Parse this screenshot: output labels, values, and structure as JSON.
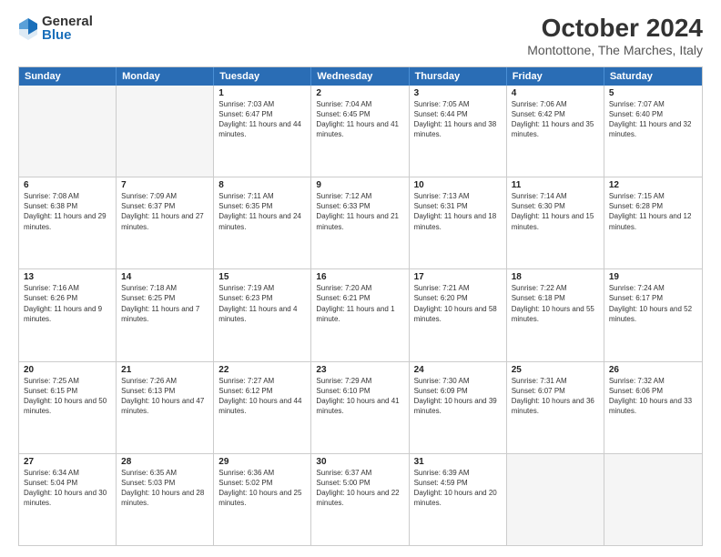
{
  "logo": {
    "general": "General",
    "blue": "Blue"
  },
  "title": "October 2024",
  "location": "Montottone, The Marches, Italy",
  "days": [
    "Sunday",
    "Monday",
    "Tuesday",
    "Wednesday",
    "Thursday",
    "Friday",
    "Saturday"
  ],
  "weeks": [
    [
      {
        "day": "",
        "empty": true
      },
      {
        "day": "",
        "empty": true
      },
      {
        "day": "1",
        "sunrise": "Sunrise: 7:03 AM",
        "sunset": "Sunset: 6:47 PM",
        "daylight": "Daylight: 11 hours and 44 minutes."
      },
      {
        "day": "2",
        "sunrise": "Sunrise: 7:04 AM",
        "sunset": "Sunset: 6:45 PM",
        "daylight": "Daylight: 11 hours and 41 minutes."
      },
      {
        "day": "3",
        "sunrise": "Sunrise: 7:05 AM",
        "sunset": "Sunset: 6:44 PM",
        "daylight": "Daylight: 11 hours and 38 minutes."
      },
      {
        "day": "4",
        "sunrise": "Sunrise: 7:06 AM",
        "sunset": "Sunset: 6:42 PM",
        "daylight": "Daylight: 11 hours and 35 minutes."
      },
      {
        "day": "5",
        "sunrise": "Sunrise: 7:07 AM",
        "sunset": "Sunset: 6:40 PM",
        "daylight": "Daylight: 11 hours and 32 minutes."
      }
    ],
    [
      {
        "day": "6",
        "sunrise": "Sunrise: 7:08 AM",
        "sunset": "Sunset: 6:38 PM",
        "daylight": "Daylight: 11 hours and 29 minutes."
      },
      {
        "day": "7",
        "sunrise": "Sunrise: 7:09 AM",
        "sunset": "Sunset: 6:37 PM",
        "daylight": "Daylight: 11 hours and 27 minutes."
      },
      {
        "day": "8",
        "sunrise": "Sunrise: 7:11 AM",
        "sunset": "Sunset: 6:35 PM",
        "daylight": "Daylight: 11 hours and 24 minutes."
      },
      {
        "day": "9",
        "sunrise": "Sunrise: 7:12 AM",
        "sunset": "Sunset: 6:33 PM",
        "daylight": "Daylight: 11 hours and 21 minutes."
      },
      {
        "day": "10",
        "sunrise": "Sunrise: 7:13 AM",
        "sunset": "Sunset: 6:31 PM",
        "daylight": "Daylight: 11 hours and 18 minutes."
      },
      {
        "day": "11",
        "sunrise": "Sunrise: 7:14 AM",
        "sunset": "Sunset: 6:30 PM",
        "daylight": "Daylight: 11 hours and 15 minutes."
      },
      {
        "day": "12",
        "sunrise": "Sunrise: 7:15 AM",
        "sunset": "Sunset: 6:28 PM",
        "daylight": "Daylight: 11 hours and 12 minutes."
      }
    ],
    [
      {
        "day": "13",
        "sunrise": "Sunrise: 7:16 AM",
        "sunset": "Sunset: 6:26 PM",
        "daylight": "Daylight: 11 hours and 9 minutes."
      },
      {
        "day": "14",
        "sunrise": "Sunrise: 7:18 AM",
        "sunset": "Sunset: 6:25 PM",
        "daylight": "Daylight: 11 hours and 7 minutes."
      },
      {
        "day": "15",
        "sunrise": "Sunrise: 7:19 AM",
        "sunset": "Sunset: 6:23 PM",
        "daylight": "Daylight: 11 hours and 4 minutes."
      },
      {
        "day": "16",
        "sunrise": "Sunrise: 7:20 AM",
        "sunset": "Sunset: 6:21 PM",
        "daylight": "Daylight: 11 hours and 1 minute."
      },
      {
        "day": "17",
        "sunrise": "Sunrise: 7:21 AM",
        "sunset": "Sunset: 6:20 PM",
        "daylight": "Daylight: 10 hours and 58 minutes."
      },
      {
        "day": "18",
        "sunrise": "Sunrise: 7:22 AM",
        "sunset": "Sunset: 6:18 PM",
        "daylight": "Daylight: 10 hours and 55 minutes."
      },
      {
        "day": "19",
        "sunrise": "Sunrise: 7:24 AM",
        "sunset": "Sunset: 6:17 PM",
        "daylight": "Daylight: 10 hours and 52 minutes."
      }
    ],
    [
      {
        "day": "20",
        "sunrise": "Sunrise: 7:25 AM",
        "sunset": "Sunset: 6:15 PM",
        "daylight": "Daylight: 10 hours and 50 minutes."
      },
      {
        "day": "21",
        "sunrise": "Sunrise: 7:26 AM",
        "sunset": "Sunset: 6:13 PM",
        "daylight": "Daylight: 10 hours and 47 minutes."
      },
      {
        "day": "22",
        "sunrise": "Sunrise: 7:27 AM",
        "sunset": "Sunset: 6:12 PM",
        "daylight": "Daylight: 10 hours and 44 minutes."
      },
      {
        "day": "23",
        "sunrise": "Sunrise: 7:29 AM",
        "sunset": "Sunset: 6:10 PM",
        "daylight": "Daylight: 10 hours and 41 minutes."
      },
      {
        "day": "24",
        "sunrise": "Sunrise: 7:30 AM",
        "sunset": "Sunset: 6:09 PM",
        "daylight": "Daylight: 10 hours and 39 minutes."
      },
      {
        "day": "25",
        "sunrise": "Sunrise: 7:31 AM",
        "sunset": "Sunset: 6:07 PM",
        "daylight": "Daylight: 10 hours and 36 minutes."
      },
      {
        "day": "26",
        "sunrise": "Sunrise: 7:32 AM",
        "sunset": "Sunset: 6:06 PM",
        "daylight": "Daylight: 10 hours and 33 minutes."
      }
    ],
    [
      {
        "day": "27",
        "sunrise": "Sunrise: 6:34 AM",
        "sunset": "Sunset: 5:04 PM",
        "daylight": "Daylight: 10 hours and 30 minutes."
      },
      {
        "day": "28",
        "sunrise": "Sunrise: 6:35 AM",
        "sunset": "Sunset: 5:03 PM",
        "daylight": "Daylight: 10 hours and 28 minutes."
      },
      {
        "day": "29",
        "sunrise": "Sunrise: 6:36 AM",
        "sunset": "Sunset: 5:02 PM",
        "daylight": "Daylight: 10 hours and 25 minutes."
      },
      {
        "day": "30",
        "sunrise": "Sunrise: 6:37 AM",
        "sunset": "Sunset: 5:00 PM",
        "daylight": "Daylight: 10 hours and 22 minutes."
      },
      {
        "day": "31",
        "sunrise": "Sunrise: 6:39 AM",
        "sunset": "Sunset: 4:59 PM",
        "daylight": "Daylight: 10 hours and 20 minutes."
      },
      {
        "day": "",
        "empty": true
      },
      {
        "day": "",
        "empty": true
      }
    ]
  ]
}
